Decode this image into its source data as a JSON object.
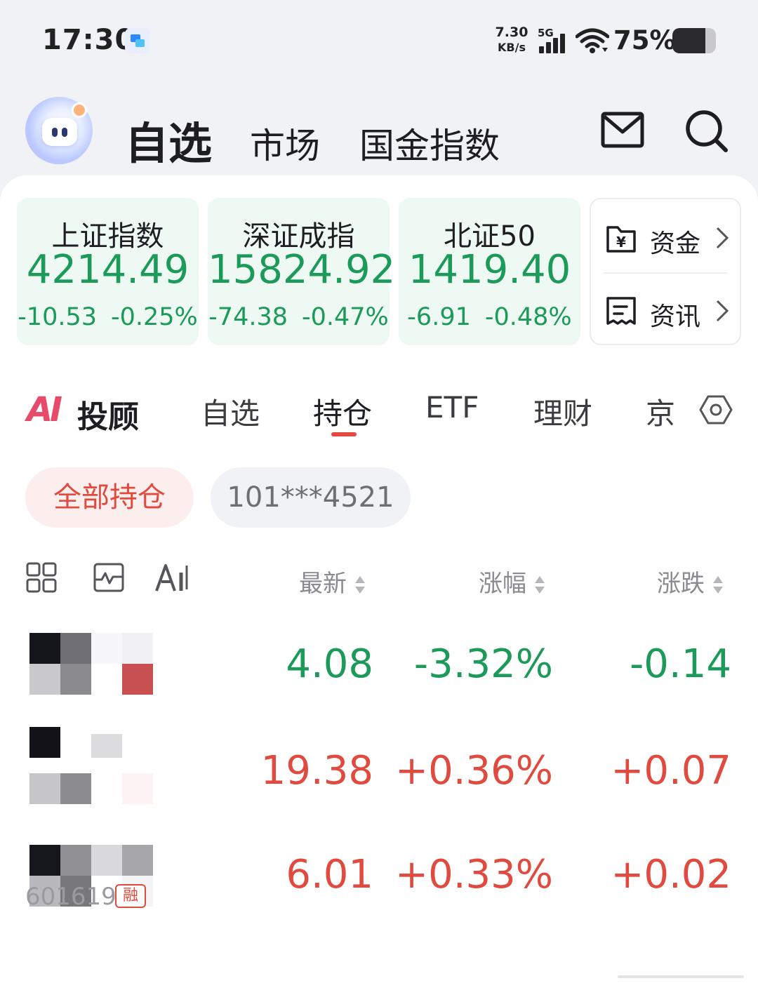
{
  "status_bar": {
    "time": "17:30",
    "net_speed_value": "7.30",
    "net_speed_unit": "KB/s",
    "network": "5G",
    "battery_percent": "75%",
    "battery_level": 0.75
  },
  "header": {
    "tabs": [
      {
        "label": "自选",
        "active": true
      },
      {
        "label": "市场",
        "active": false
      },
      {
        "label": "国金指数",
        "active": false
      }
    ],
    "icons": [
      "mail-icon",
      "search-icon"
    ]
  },
  "indices": [
    {
      "name": "上证指数",
      "value": "4214.49",
      "change": "-10.53",
      "change_pct": "-0.25%",
      "trend": "down"
    },
    {
      "name": "深证成指",
      "value": "15824.92",
      "change": "-74.38",
      "change_pct": "-0.47%",
      "trend": "down"
    },
    {
      "name": "北证50",
      "value": "1419.40",
      "change": "-6.91",
      "change_pct": "-0.48%",
      "trend": "down"
    }
  ],
  "side_links": [
    {
      "label": "资金",
      "icon": "wallet-yuan-icon"
    },
    {
      "label": "资讯",
      "icon": "news-icon"
    }
  ],
  "sub_tabs": {
    "logo_ai": "AI",
    "logo_text": "投顾",
    "items": [
      {
        "label": "自选",
        "active": false
      },
      {
        "label": "持仓",
        "active": true
      },
      {
        "label": "ETF",
        "active": false
      },
      {
        "label": "理财",
        "active": false
      },
      {
        "label": "京",
        "active": false
      }
    ]
  },
  "filters": {
    "chips": [
      {
        "label": "全部持仓",
        "active": true
      },
      {
        "label": "101***4521",
        "active": false
      }
    ]
  },
  "table": {
    "columns": [
      "最新",
      "涨幅",
      "涨跌"
    ],
    "rows": [
      {
        "price": "4.08",
        "pct": "-3.32%",
        "change": "-0.14",
        "trend": "down",
        "badge": "",
        "code_visible": ""
      },
      {
        "price": "19.38",
        "pct": "+0.36%",
        "change": "+0.07",
        "trend": "up",
        "badge": "",
        "code_visible": ""
      },
      {
        "price": "6.01",
        "pct": "+0.33%",
        "change": "+0.02",
        "trend": "up",
        "badge": "融",
        "code_visible": "601619"
      }
    ]
  },
  "colors": {
    "down_green": "#1b9a59",
    "up_red": "#e04a3f",
    "index_card_bg": "#eef9f3",
    "chip_active_bg": "#fdeeee"
  }
}
